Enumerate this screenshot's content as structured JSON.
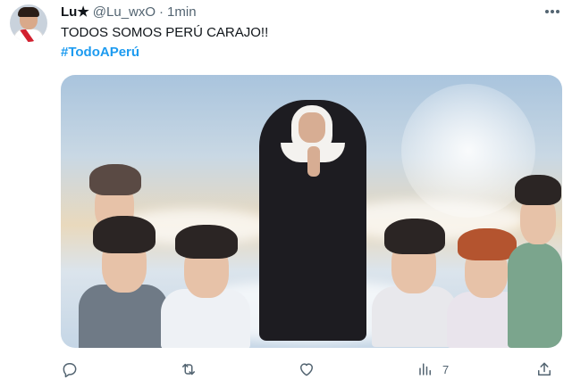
{
  "tweet": {
    "author": {
      "display_name": "Lu★",
      "handle": "@Lu_wxO",
      "separator": "·",
      "time": "1min"
    },
    "text": "TODOS SOMOS PERÚ CARAJO!!",
    "hashtag": "#TodoAPerú",
    "media": {
      "watermark": "@..."
    },
    "actions": {
      "reply_count": "",
      "retweet_count": "",
      "like_count": "",
      "views_count": "7"
    }
  },
  "icons": {
    "more": "more-horizontal-icon",
    "reply": "reply-icon",
    "retweet": "retweet-icon",
    "like": "heart-icon",
    "views": "views-bar-chart-icon",
    "share": "share-icon"
  },
  "colors": {
    "text": "#0f1419",
    "secondary": "#536471",
    "link": "#1d9bf0",
    "background": "#ffffff"
  }
}
